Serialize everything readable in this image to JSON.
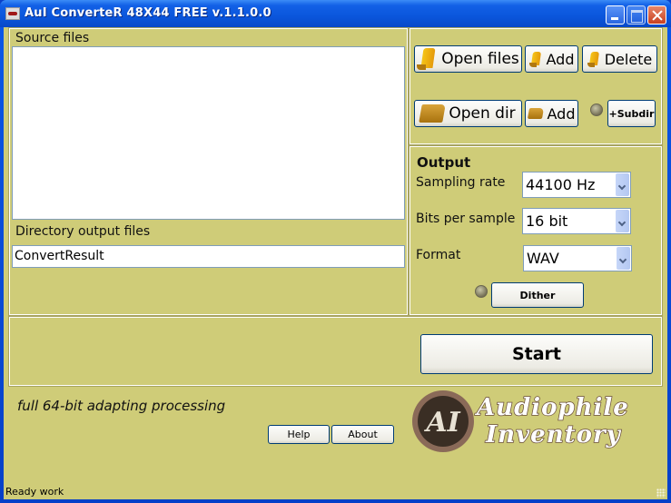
{
  "window": {
    "title": "AuI ConverteR 48X44 FREE v.1.1.0.0",
    "controls": [
      "minimize",
      "maximize",
      "close"
    ]
  },
  "source": {
    "label": "Source files",
    "files": []
  },
  "output_dir": {
    "label": "Directory output files",
    "value": "ConvertResult"
  },
  "file_buttons": {
    "open_files": "Open files",
    "add_files": "Add",
    "delete": "Delete",
    "open_dir": "Open dir",
    "add_dir": "Add",
    "subdir": "+Subdir"
  },
  "output": {
    "heading": "Output",
    "sampling_rate_label": "Sampling rate",
    "sampling_rate_value": "44100 Hz",
    "bits_label": "Bits per sample",
    "bits_value": "16 bit",
    "format_label": "Format",
    "format_value": "WAV",
    "dither": "Dither"
  },
  "actions": {
    "start": "Start",
    "help": "Help",
    "about": "About"
  },
  "slogan": "full 64-bit adapting processing",
  "logo": {
    "monogram": "AI",
    "line1": "Audiophile",
    "line2": "Inventory"
  },
  "status": "Ready work"
}
